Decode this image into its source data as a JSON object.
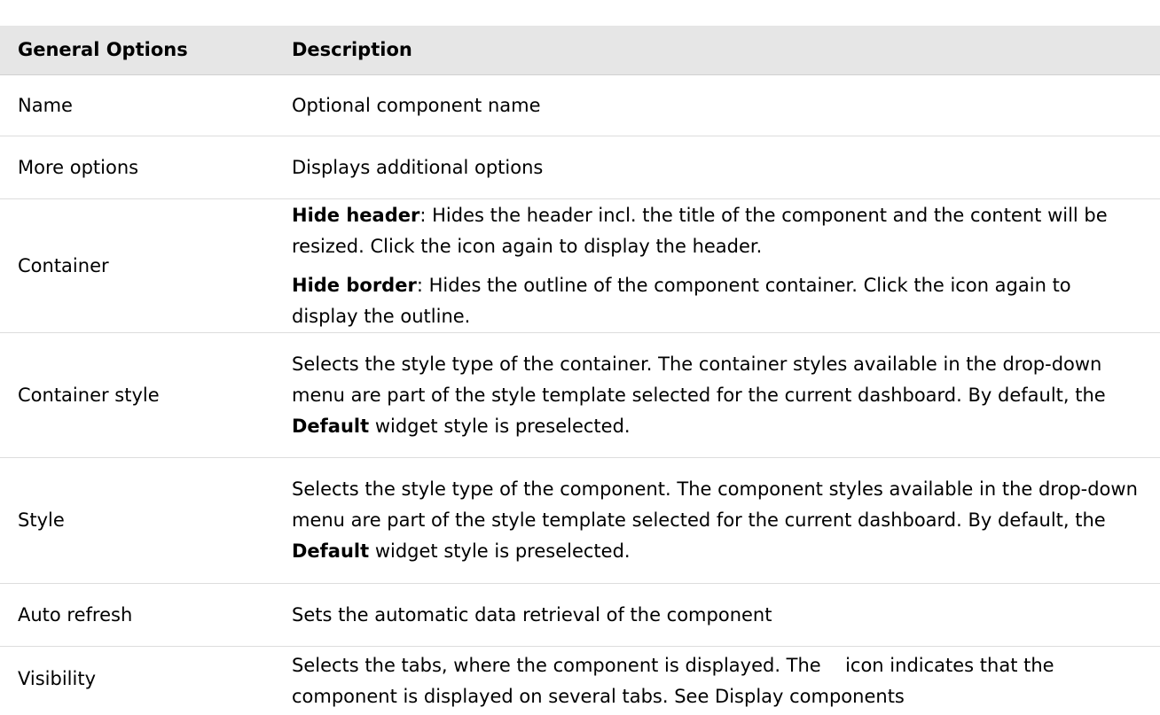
{
  "header": {
    "col1": "General Options",
    "col2": "Description"
  },
  "rows": [
    {
      "option": "Name",
      "description": "Optional component name"
    },
    {
      "option": "More options",
      "description": "Displays additional options"
    },
    {
      "option": "Container",
      "items": [
        {
          "term": "Hide header",
          "text": ": Hides the header incl. the title of the component and the content will be resized. Click the icon again to display the header."
        },
        {
          "term": "Hide border",
          "text": ": Hides the outline of the component container. Click the icon again to display the outline."
        }
      ]
    },
    {
      "option": "Container style",
      "description_before": "Selects the style type of the container. The container styles available in the drop-down menu are part of the style template selected for the current dashboard. By default, the ",
      "bold": "Default",
      "description_after": " widget style is preselected."
    },
    {
      "option": "Style",
      "description_before": "Selects the style type of the component. The component styles available in the drop-down menu are part of the style template selected for the current dashboard. By default, the ",
      "bold": "Default",
      "description_after": " widget style is preselected."
    },
    {
      "option": "Auto refresh",
      "description": "Sets the automatic data retrieval of the component"
    },
    {
      "option": "Visibility",
      "description_before": "Selects the tabs, where the component is displayed. The ",
      "description_after": " icon indicates that the component is displayed on several tabs. See Display components"
    }
  ]
}
